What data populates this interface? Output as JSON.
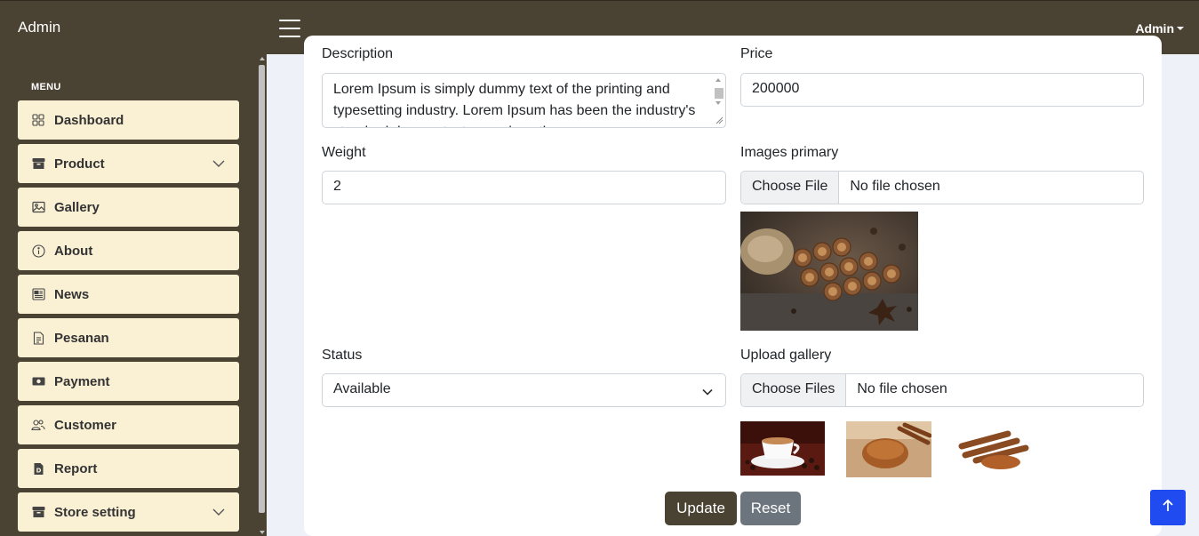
{
  "header": {
    "brand": "Admin",
    "user_menu": "Admin"
  },
  "sidebar": {
    "heading": "MENU",
    "items": [
      {
        "label": "Dashboard",
        "icon": "grid-icon"
      },
      {
        "label": "Product",
        "icon": "archive-icon",
        "has_submenu": true
      },
      {
        "label": "Gallery",
        "icon": "image-icon"
      },
      {
        "label": "About",
        "icon": "info-circle-icon"
      },
      {
        "label": "News",
        "icon": "newspaper-icon"
      },
      {
        "label": "Pesanan",
        "icon": "document-icon"
      },
      {
        "label": "Payment",
        "icon": "cash-icon"
      },
      {
        "label": "Customer",
        "icon": "people-icon"
      },
      {
        "label": "Report",
        "icon": "report-icon"
      },
      {
        "label": "Store setting",
        "icon": "archive-icon",
        "has_submenu": true
      }
    ]
  },
  "form": {
    "description_label": "Description",
    "description_value": "Lorem Ipsum is simply dummy text of the printing and typesetting industry. Lorem Ipsum has been the industry's standard dummy text ever since the",
    "price_label": "Price",
    "price_value": "200000",
    "weight_label": "Weight",
    "weight_value": "2",
    "images_primary_label": "Images primary",
    "images_primary_button": "Choose File",
    "images_primary_file": "No file chosen",
    "status_label": "Status",
    "status_value": "Available",
    "upload_gallery_label": "Upload gallery",
    "upload_gallery_button": "Choose Files",
    "upload_gallery_file": "No file chosen",
    "update_button": "Update",
    "reset_button": "Reset"
  },
  "colors": {
    "topbar": "#4a4232",
    "menu_item_bg": "#faf1d5",
    "update_button": "#4a4232",
    "reset_button": "#6c757d",
    "back_to_top": "#1f4bf0"
  }
}
